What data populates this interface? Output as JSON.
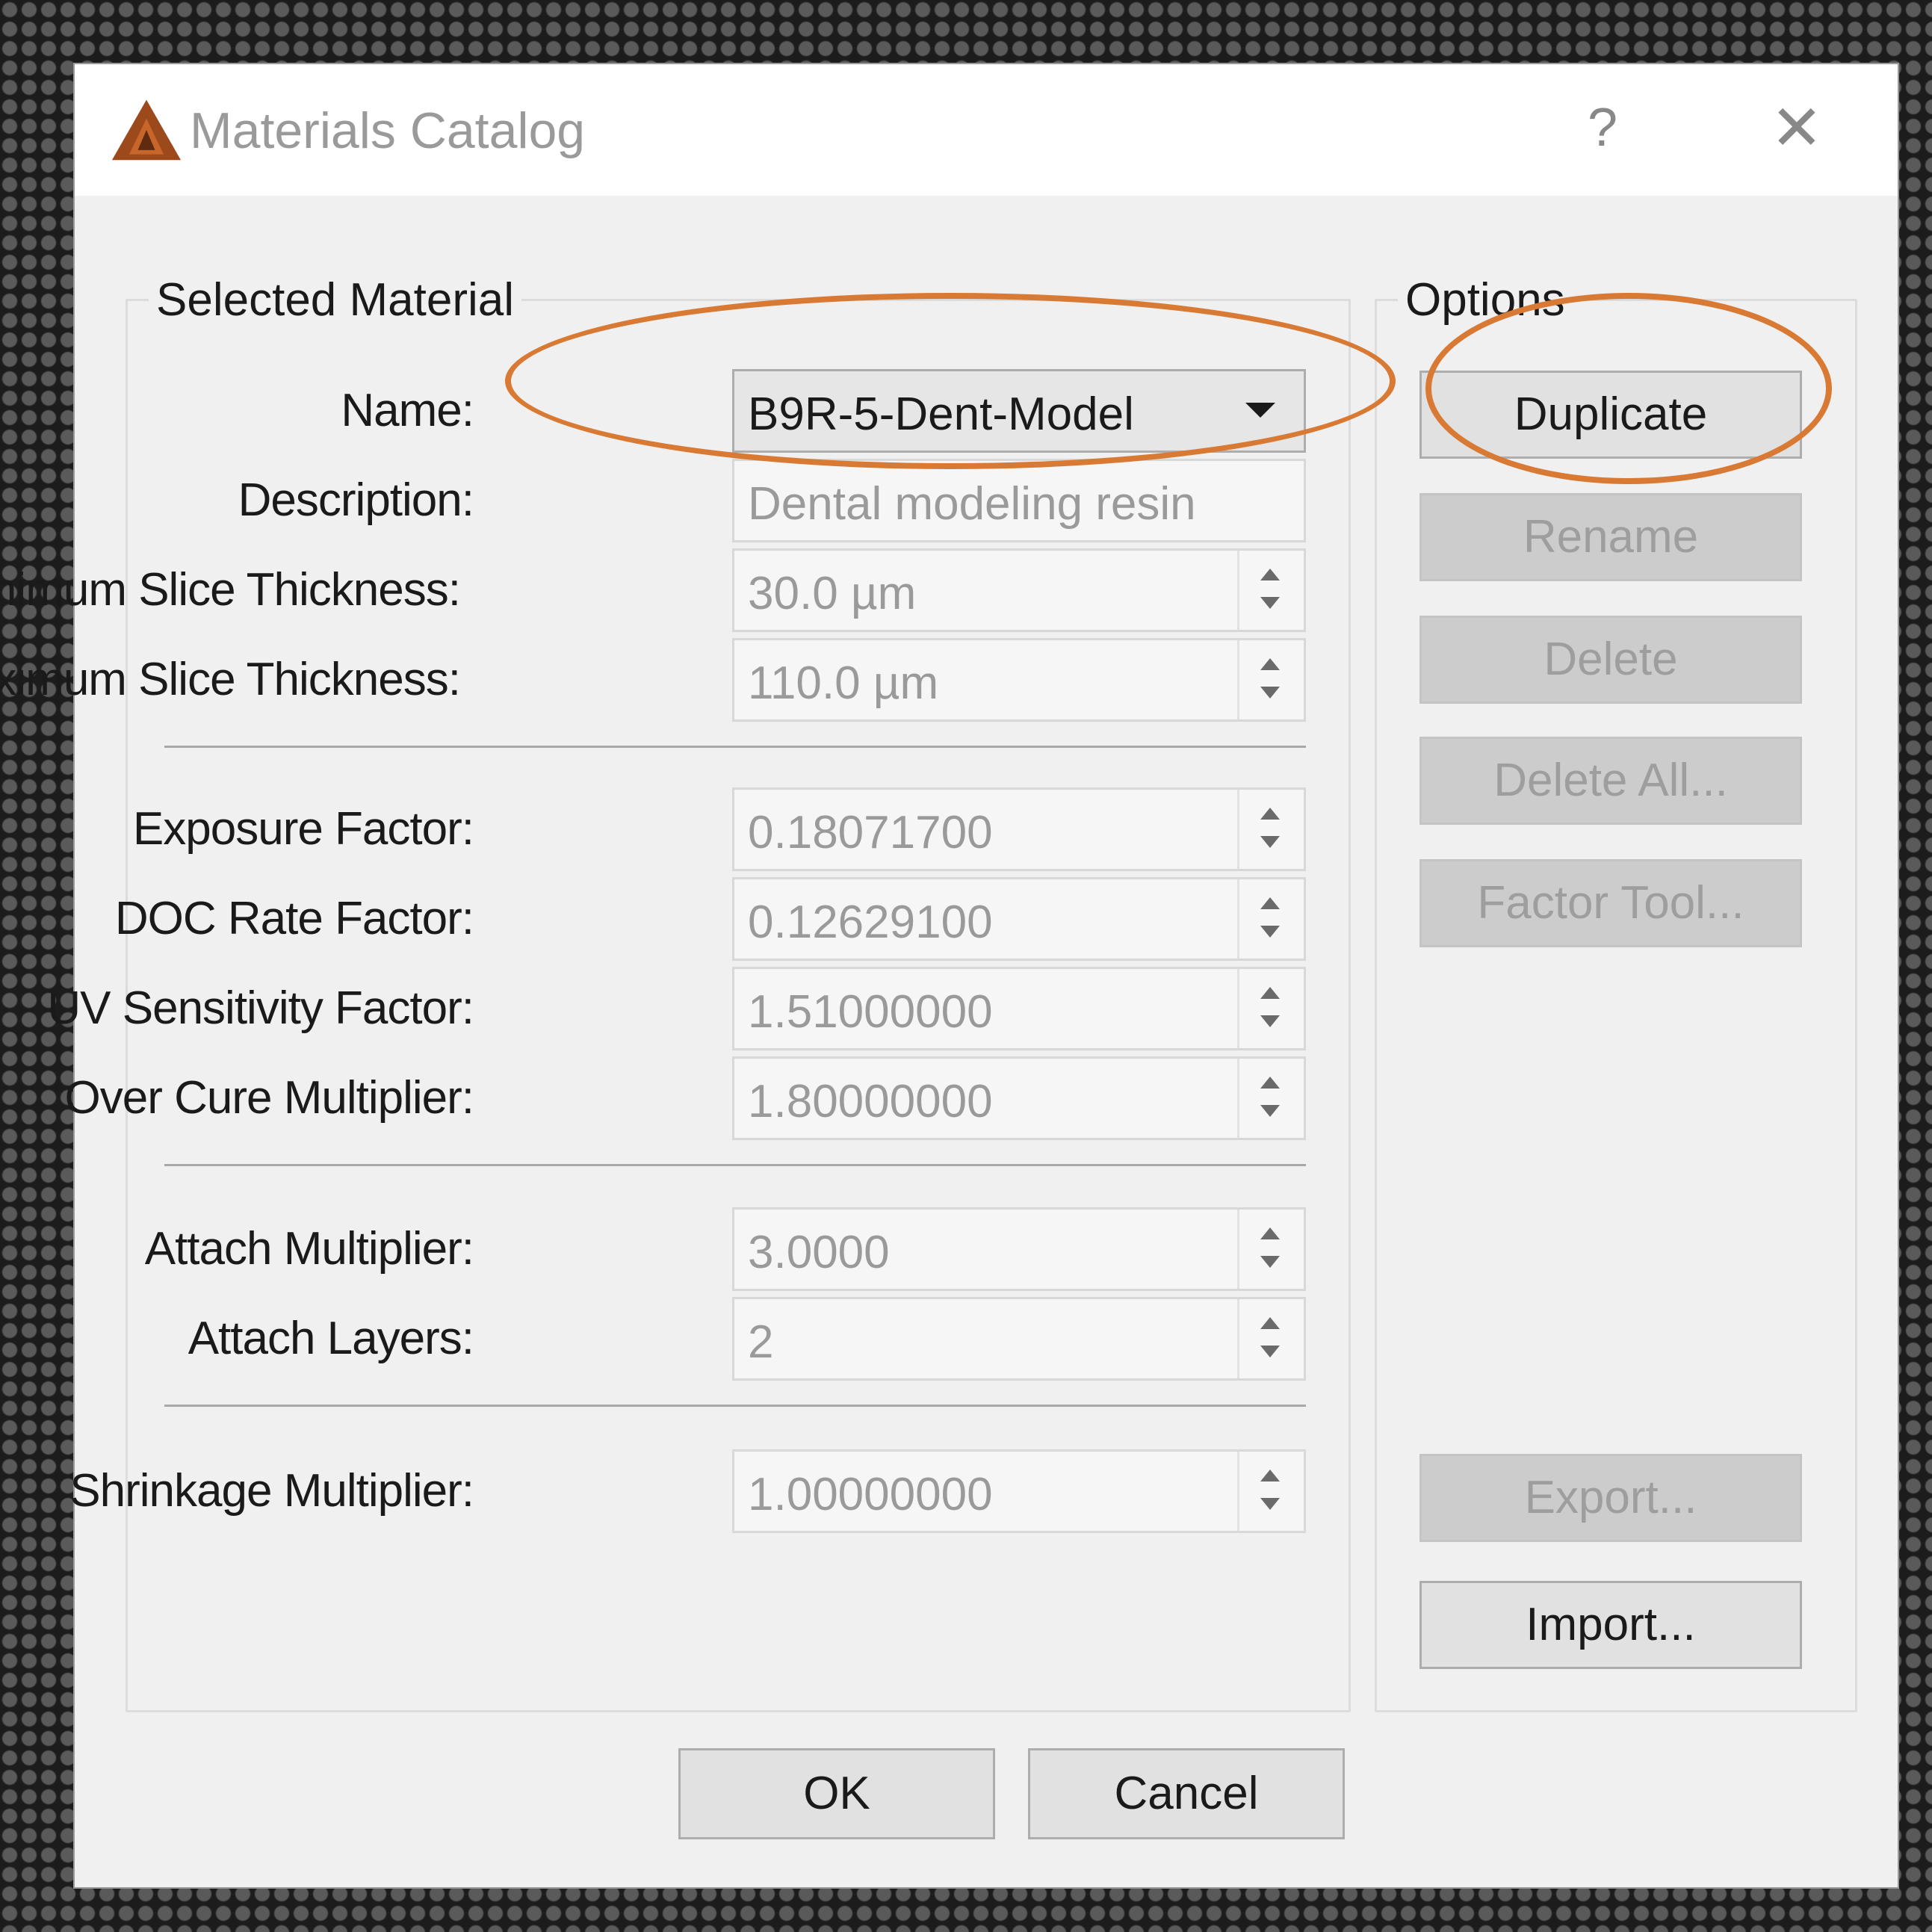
{
  "window": {
    "title": "Materials Catalog",
    "help_glyph": "?",
    "close_glyph": "✕",
    "app_icon": "triangle-logo-icon"
  },
  "selected_material": {
    "legend": "Selected Material",
    "name": {
      "label": "Name:",
      "value": "B9R-5-Dent-Model"
    },
    "description": {
      "label": "Description:",
      "placeholder": "Dental modeling resin"
    },
    "min_slice": {
      "label": "Minimum Slice Thickness:",
      "value": "30.0 µm"
    },
    "max_slice": {
      "label": "Maximum Slice Thickness:",
      "value": "110.0 µm"
    },
    "exposure_factor": {
      "label": "Exposure Factor:",
      "value": "0.18071700"
    },
    "doc_rate_factor": {
      "label": "DOC Rate Factor:",
      "value": "0.12629100"
    },
    "uv_sensitivity": {
      "label": "UV Sensitivity Factor:",
      "value": "1.51000000"
    },
    "over_cure": {
      "label": "Over Cure Multiplier:",
      "value": "1.80000000"
    },
    "attach_multiplier": {
      "label": "Attach Multiplier:",
      "value": "3.0000"
    },
    "attach_layers": {
      "label": "Attach Layers:",
      "value": "2"
    },
    "shrinkage": {
      "label": "Shrinkage Multiplier:",
      "value": "1.00000000"
    }
  },
  "options": {
    "legend": "Options",
    "duplicate": "Duplicate",
    "rename": "Rename",
    "delete": "Delete",
    "delete_all": "Delete All...",
    "factor_tool": "Factor Tool...",
    "export": "Export...",
    "import": "Import..."
  },
  "footer": {
    "ok": "OK",
    "cancel": "Cancel"
  },
  "colors": {
    "annotation": "#d87a34",
    "dialog_bg": "#f0f0f0",
    "disabled_button": "#cccccc"
  }
}
